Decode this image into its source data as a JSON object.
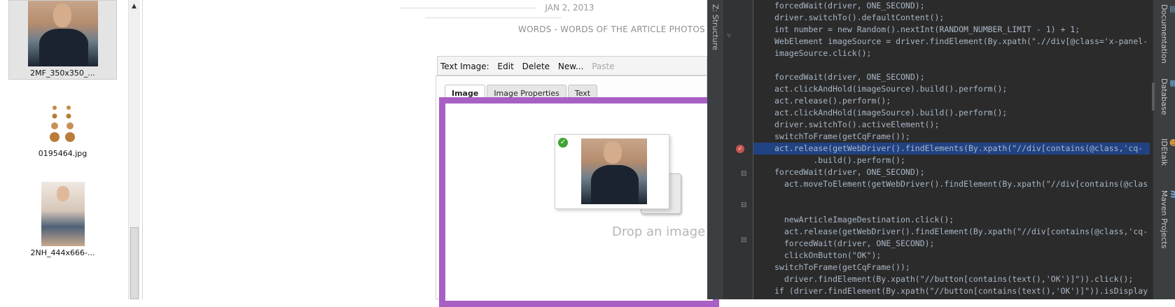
{
  "assets": {
    "items": [
      {
        "caption": "2MF_350x350_..."
      },
      {
        "caption": "0195464.jpg"
      },
      {
        "caption": "2NH_444x666-..."
      }
    ]
  },
  "editor": {
    "date": "JAN 2, 2013",
    "article_title": "WORDS - WORDS OF THE ARTICLE PHOTOS - PHO",
    "toolbar": {
      "label": "Text Image:",
      "edit": "Edit",
      "delete": "Delete",
      "new": "New...",
      "paste": "Paste"
    },
    "tabs": [
      "Image",
      "Image Properties",
      "Text"
    ],
    "drop_text": "Drop an image"
  },
  "ide": {
    "left_tab": "Z: Structure",
    "right_tabs": [
      "Documentation",
      "Database",
      "IDEtalk",
      "Maven Projects"
    ],
    "lines": [
      "forcedWait(driver, ONE_SECOND);",
      "driver.switchTo().defaultContent();",
      "int number = new Random().nextInt(RANDOM_NUMBER_LIMIT - 1) + 1;",
      "WebElement imageSource = driver.findElement(By.xpath(\".//div[@class='x-panel-",
      "imageSource.click();",
      "",
      "forcedWait(driver, ONE_SECOND);",
      "act.clickAndHold(imageSource).build().perform();",
      "act.release().perform();",
      "act.clickAndHold(imageSource).build().perform();",
      "driver.switchTo().activeElement();",
      "switchToFrame(getCqFrame());",
      "act.release(getWebDriver().findElements(By.xpath(\"//div[contains(@class,'cq-",
      "        .build().perform();",
      "forcedWait(driver, ONE_SECOND);",
      "  act.moveToElement(getWebDriver().findElement(By.xpath(\"//div[contains(@clas",
      "",
      "",
      "  newArticleImageDestination.click();",
      "  act.release(getWebDriver().findElement(By.xpath(\"//div[contains(@class,'cq-",
      "  forcedWait(driver, ONE_SECOND);",
      "  clickOnButton(\"OK\");",
      "switchToFrame(getCqFrame());",
      "  driver.findElement(By.xpath(\"//button[contains(text(),'OK')]\")).click();",
      "if (driver.findElement(By.xpath(\"//button[contains(text(),'OK')]\")).isDisplay"
    ]
  },
  "colors": {
    "dropzone_border": "#a860c4",
    "ide_background": "#2b2b2b",
    "selection_highlight": "#214283"
  }
}
